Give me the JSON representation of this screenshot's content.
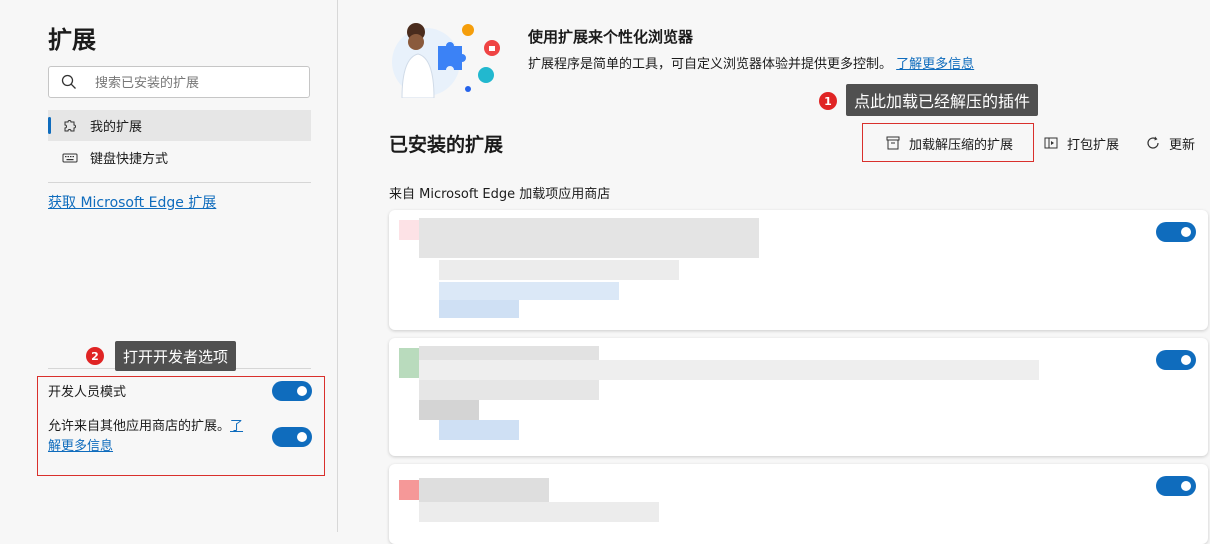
{
  "sidebar": {
    "title": "扩展",
    "search": {
      "placeholder": "搜索已安装的扩展"
    },
    "nav": [
      {
        "label": "我的扩展",
        "icon": "puzzle-icon",
        "active": true
      },
      {
        "label": "键盘快捷方式",
        "icon": "keyboard-icon",
        "active": false
      }
    ],
    "get_extensions_link": "获取 Microsoft Edge 扩展",
    "developer_mode": {
      "label": "开发人员模式",
      "enabled": true
    },
    "allow_other_stores": {
      "label_line1": "允许来自其他应用商店的扩展。",
      "link_part1": "了",
      "link_part2": "解更多信息",
      "enabled": true
    }
  },
  "hero": {
    "title": "使用扩展来个性化浏览器",
    "description": "扩展程序是简单的工具，可自定义浏览器体验并提供更多控制。",
    "learn_more": "了解更多信息"
  },
  "main": {
    "installed_title": "已安装的扩展",
    "actions": [
      {
        "label": "加载解压缩的扩展",
        "icon": "load-unpacked-icon"
      },
      {
        "label": "打包扩展",
        "icon": "pack-icon"
      },
      {
        "label": "更新",
        "icon": "refresh-icon"
      }
    ],
    "source_label": "来自 Microsoft Edge 加载项应用商店",
    "extension_cards": [
      {
        "enabled": true
      },
      {
        "enabled": true
      },
      {
        "enabled": true
      }
    ]
  },
  "annotations": {
    "callout1": {
      "number": "1",
      "text": "点此加载已经解压的插件"
    },
    "callout2": {
      "number": "2",
      "text": "打开开发者选项"
    }
  },
  "colors": {
    "accent": "#0f6cbd",
    "annotation_red": "#d9302c",
    "callout_bg": "#505050"
  }
}
